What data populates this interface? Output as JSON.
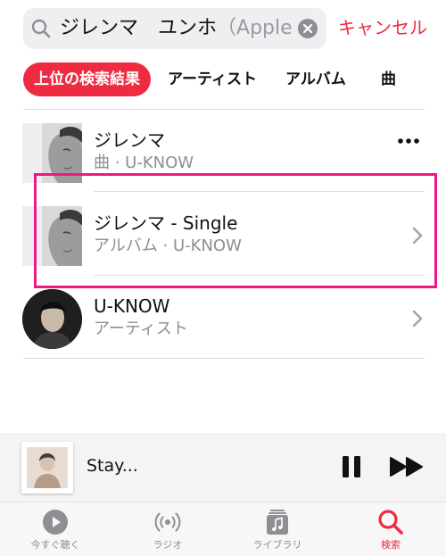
{
  "search": {
    "query": "ジレンマ　ユンホ",
    "ghost_text": "（Apple",
    "cancel_label": "キャンセル"
  },
  "scope_tabs": [
    {
      "label": "上位の検索結果",
      "selected": true
    },
    {
      "label": "アーティスト",
      "selected": false
    },
    {
      "label": "アルバム",
      "selected": false
    },
    {
      "label": "曲",
      "selected": false
    }
  ],
  "results": [
    {
      "title": "ジレンマ",
      "subtitle": "曲 · U-KNOW",
      "accessory": "more-icon"
    },
    {
      "title": "ジレンマ - Single",
      "subtitle": "アルバム · U-KNOW",
      "accessory": "chevron-right-icon"
    },
    {
      "title": "U-KNOW",
      "subtitle": "アーティスト",
      "accessory": "chevron-right-icon"
    }
  ],
  "now_playing": {
    "title": "Stay...",
    "controls": [
      "pause-icon",
      "fast-forward-icon"
    ]
  },
  "tab_bar": [
    {
      "label": "今すぐ聴く",
      "icon": "play-circle-icon",
      "selected": false
    },
    {
      "label": "ラジオ",
      "icon": "radio-icon",
      "selected": false
    },
    {
      "label": "ライブラリ",
      "icon": "library-icon",
      "selected": false
    },
    {
      "label": "検索",
      "icon": "search-icon",
      "selected": true
    }
  ],
  "colors": {
    "accent": "#ef2b42",
    "highlight_box": "#f0168a",
    "secondary_text": "#8e8e93"
  }
}
